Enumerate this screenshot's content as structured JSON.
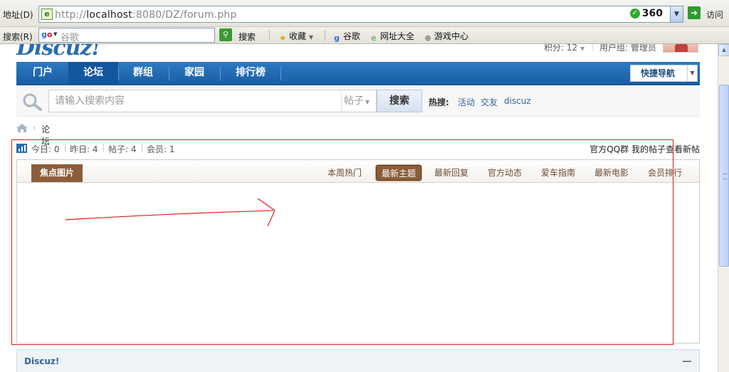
{
  "browser": {
    "address_label": "地址(D)",
    "url_prefix": "http://",
    "url_host": "localhost",
    "url_rest": ":8080/DZ/forum.php",
    "badge": "360",
    "go_label": "访问",
    "search_label": "搜索(R)",
    "search_placeholder": "谷歌",
    "search_button": "搜索",
    "toolbar": [
      "收藏",
      "谷歌",
      "网址大全",
      "游戏中心"
    ]
  },
  "site": {
    "logo": "Discuz!",
    "credits": "积分: 12",
    "usergroup": "用户组: 管理员"
  },
  "nav": {
    "tabs": [
      "门户",
      "论坛",
      "群组",
      "家园",
      "排行榜"
    ],
    "active": "论坛",
    "quick_nav": "快捷导航"
  },
  "search": {
    "placeholder": "请输入搜索内容",
    "type": "帖子",
    "button": "搜索",
    "hot_label": "热搜:",
    "hot": [
      "活动",
      "交友",
      "discuz"
    ]
  },
  "breadcrumb": {
    "current": "论坛",
    "separator": "›"
  },
  "stats": {
    "today": "今日: 0",
    "yesterday": "昨日: 4",
    "posts": "帖子: 4",
    "members": "会员: 1",
    "right_links": "官方QQ群 我的帖子查看新帖"
  },
  "focus": {
    "title": "焦点图片",
    "tabs": [
      "本周热门",
      "最新主题",
      "最新回复",
      "官方动态",
      "爱车指南",
      "最新电影",
      "会员排行"
    ],
    "active": "最新主题"
  },
  "bottom": {
    "title": "Discuz!",
    "collapse": "—"
  },
  "colors": {
    "nav_blue": "#1a5ea4",
    "focus_brown": "#8b5d3a",
    "annotation_red": "#d62020"
  }
}
